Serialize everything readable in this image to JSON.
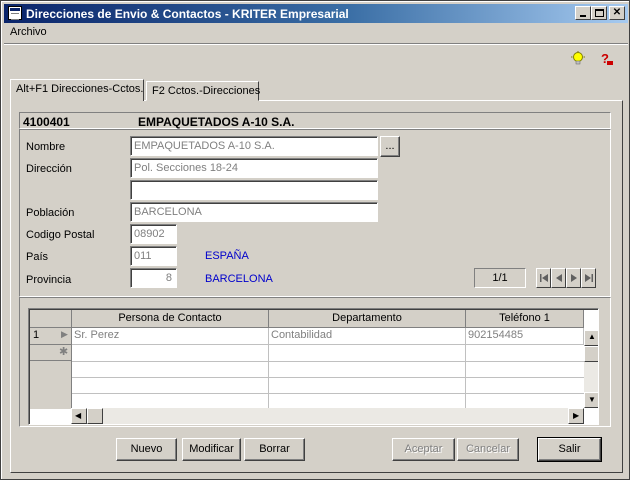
{
  "window": {
    "title": "Direcciones de Envio & Contactos - KRITER Empresarial"
  },
  "menu": {
    "archivo": "Archivo"
  },
  "toolbar": {
    "icons": [
      "lightbulb-icon",
      "help-icon"
    ]
  },
  "tabs": [
    {
      "label": "Alt+F1 Direcciones-Cctos.",
      "active": true
    },
    {
      "label": "F2 Cctos.-Direcciones",
      "active": false
    }
  ],
  "company": {
    "code": "4100401",
    "name": "EMPAQUETADOS A-10 S.A."
  },
  "form": {
    "nombre_label": "Nombre",
    "nombre": "EMPAQUETADOS A-10 S.A.",
    "direccion_label": "Dirección",
    "direccion1": "Pol. Secciones 18-24",
    "direccion2": "",
    "poblacion_label": "Población",
    "poblacion": "BARCELONA",
    "cp_label": "Codigo Postal",
    "cp": "08902",
    "pais_label": "País",
    "pais_code": "011",
    "pais_name": "ESPAÑA",
    "provincia_label": "Provincia",
    "provincia_code": "8",
    "provincia_name": "BARCELONA",
    "ellipsis": "..."
  },
  "record_counter": "1/1",
  "grid": {
    "columns": [
      "Persona de Contacto",
      "Departamento",
      "Teléfono 1"
    ],
    "rows": [
      {
        "num": "1",
        "persona": "Sr. Perez",
        "departamento": "Contabilidad",
        "telefono": "902154485"
      }
    ]
  },
  "buttons": {
    "nuevo": "Nuevo",
    "modificar": "Modificar",
    "borrar": "Borrar",
    "aceptar": "Aceptar",
    "cancelar": "Cancelar",
    "salir": "Salir"
  },
  "colors": {
    "title_start": "#0a246a",
    "title_end": "#a6caf0",
    "link_blue": "#0000cc",
    "face": "#d4d0c8"
  }
}
